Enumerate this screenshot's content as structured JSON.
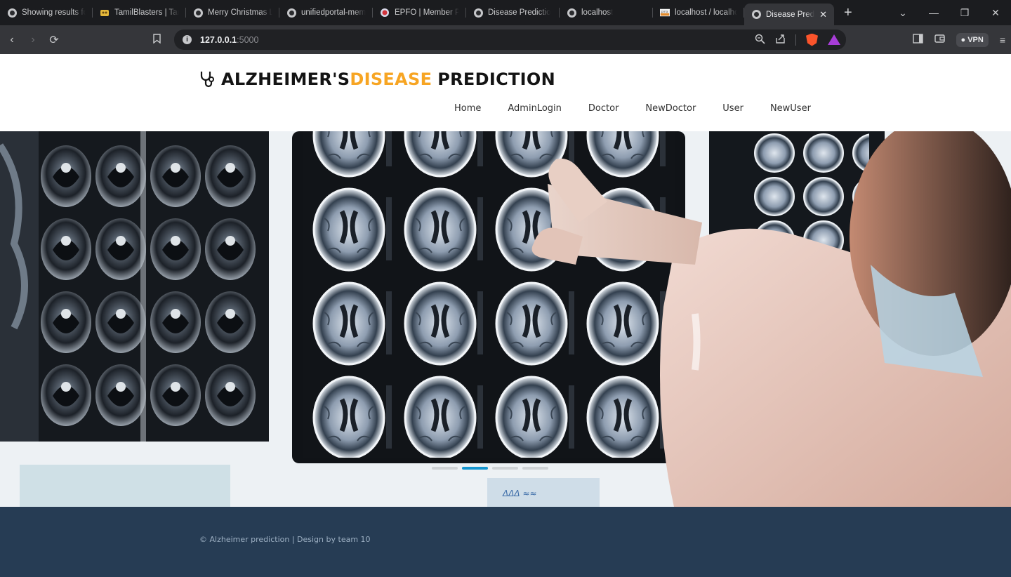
{
  "browser": {
    "tabs": [
      {
        "title": "Showing results fo",
        "icon": "globe-icon"
      },
      {
        "title": "TamilBlasters | Tam",
        "icon": "site-icon"
      },
      {
        "title": "Merry Christmas L",
        "icon": "globe-icon"
      },
      {
        "title": "unifiedportal-mem",
        "icon": "globe-icon"
      },
      {
        "title": "EPFO | Member P",
        "icon": "epfo-icon"
      },
      {
        "title": "Disease Predictio",
        "icon": "globe-icon"
      },
      {
        "title": "localhost",
        "icon": "globe-icon"
      },
      {
        "title": "localhost / localho",
        "icon": "phpmyadmin-icon"
      },
      {
        "title": "Disease Pred",
        "icon": "globe-icon",
        "active": true
      }
    ],
    "new_tab_label": "+",
    "url_host": "127.0.0.1",
    "url_port": ":5000",
    "vpn_label": "VPN"
  },
  "site": {
    "logo": {
      "part1": "ALZHEIMER'S",
      "part2": "DISEASE",
      "part3": "PREDICTION"
    },
    "menu": [
      {
        "label": "Home"
      },
      {
        "label": "AdminLogin"
      },
      {
        "label": "Doctor"
      },
      {
        "label": "NewDoctor"
      },
      {
        "label": "User"
      },
      {
        "label": "NewUser"
      }
    ],
    "carousel": {
      "slides": 4,
      "active_index": 1
    },
    "footer_text": "© Alzheimer prediction | Design by team 10"
  },
  "colors": {
    "accent": "#f7a523",
    "indicator_active": "#1496d0",
    "footer_bg": "#263c54"
  }
}
